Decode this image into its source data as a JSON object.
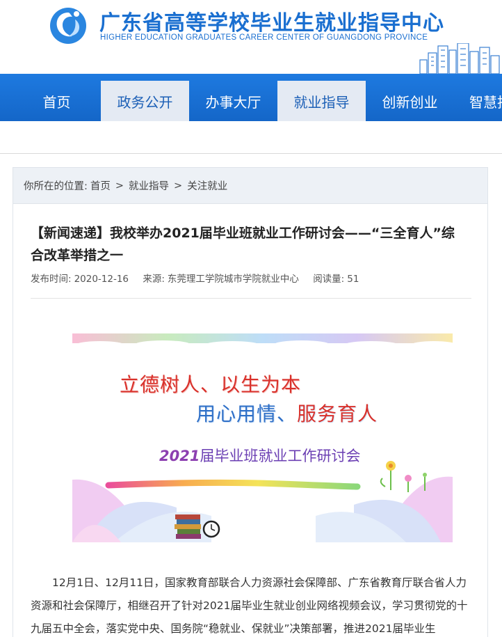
{
  "header": {
    "title": "广东省高等学校毕业生就业指导中心",
    "subtitle": "HIGHER EDUCATION GRADUATES CAREER CENTER OF GUANGDONG PROVINCE"
  },
  "nav": {
    "items": [
      {
        "label": "首页"
      },
      {
        "label": "政务公开"
      },
      {
        "label": "办事大厅"
      },
      {
        "label": "就业指导"
      },
      {
        "label": "创新创业"
      },
      {
        "label": "智慧指"
      }
    ]
  },
  "breadcrumb": {
    "prefix": "你所在的位置:",
    "items": [
      "首页",
      "就业指导",
      "关注就业"
    ],
    "separator": ">"
  },
  "article": {
    "title": "【新闻速递】我校举办2021届毕业班就业工作研讨会——“三全育人”综合改革举措之一",
    "publish_label": "发布时间:",
    "publish_date": "2020-12-16",
    "source_label": "来源:",
    "source": "东莞理工学院城市学院就业中心",
    "views_label": "阅读量:",
    "views": "51",
    "banner": {
      "line1": "立德树人、以生为本",
      "line2_part1": "用心用情、",
      "line2_part2": "服务育人",
      "sub_year": "2021",
      "sub_text": "届毕业班就业工作研讨会"
    },
    "body": "12月1日、12月11日，国家教育部联合人力资源社会保障部、广东省教育厅联合省人力资源和社会保障厅，相继召开了针对2021届毕业生就业创业网络视频会议，学习贯彻党的十九届五中全会，落实党中央、国务院“稳就业、保就业”决策部署，推进2021届毕业生"
  },
  "colors": {
    "brand_blue": "#1a6fd0",
    "nav_blue": "#1466c8",
    "nav_light": "#e4eaf3",
    "banner_red": "#d9312b",
    "banner_blue": "#2e6fc7",
    "banner_purple": "#6b3fb3"
  }
}
